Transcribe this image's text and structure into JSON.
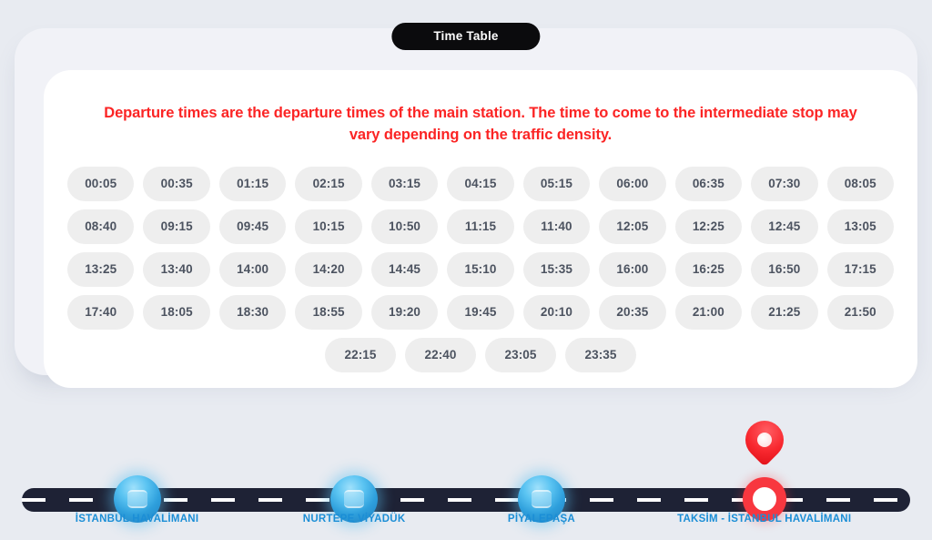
{
  "header": {
    "badge_label": "Time Table"
  },
  "card": {
    "notice": "Departure times are the departure times of the main station. The time to come to the intermediate stop may vary depending on the traffic density."
  },
  "timetable": {
    "rows": [
      [
        "00:05",
        "00:35",
        "01:15",
        "02:15",
        "03:15",
        "04:15",
        "05:15",
        "06:00",
        "06:35",
        "07:30",
        "08:05"
      ],
      [
        "08:40",
        "09:15",
        "09:45",
        "10:15",
        "10:50",
        "11:15",
        "11:40",
        "12:05",
        "12:25",
        "12:45",
        "13:05"
      ],
      [
        "13:25",
        "13:40",
        "14:00",
        "14:20",
        "14:45",
        "15:10",
        "15:35",
        "16:00",
        "16:25",
        "16:50",
        "17:15"
      ],
      [
        "17:40",
        "18:05",
        "18:30",
        "18:55",
        "19:20",
        "19:45",
        "20:10",
        "20:35",
        "21:00",
        "21:25",
        "21:50"
      ],
      [
        "22:15",
        "22:40",
        "23:05",
        "23:35"
      ]
    ]
  },
  "route": {
    "stops": [
      {
        "label": "İSTANBUL HAVALİMANI",
        "marker": "bus-stop-sphere-icon",
        "x_percent": 14.7
      },
      {
        "label": "NURTEPE VİYADÜK",
        "marker": "bus-stop-sphere-icon",
        "x_percent": 38.0
      },
      {
        "label": "PİYALEPAŞA",
        "marker": "bus-stop-sphere-icon",
        "x_percent": 58.1
      },
      {
        "label": "TAKSİM - İSTANBUL HAVALİMANI",
        "marker": "current-stop-ring-icon",
        "x_percent": 82.0
      }
    ],
    "pin_icon": "map-pin-icon"
  },
  "colors": {
    "page_background": "#e8ebf1",
    "notice_red": "#fb2424",
    "badge_black": "#0b0b0d",
    "chip_background": "#eeeeee",
    "chip_text": "#4c5360",
    "road_dark": "#1e2235",
    "stop_blue": "#1b8ed6",
    "marker_red": "#f8373f"
  }
}
